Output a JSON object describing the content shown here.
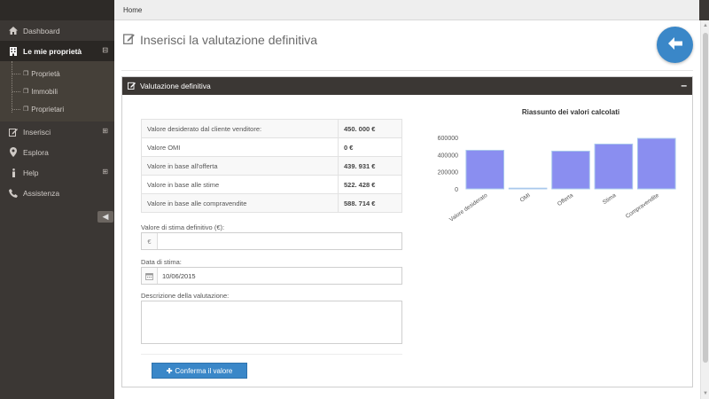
{
  "sidebar": {
    "items": [
      {
        "label": "Dashboard",
        "icon": "home-icon"
      },
      {
        "label": "Le mie proprietà",
        "icon": "building-icon"
      },
      {
        "label": "Inserisci",
        "icon": "edit-icon"
      },
      {
        "label": "Esplora",
        "icon": "map-marker-icon"
      },
      {
        "label": "Help",
        "icon": "info-icon"
      },
      {
        "label": "Assistenza",
        "icon": "phone-icon"
      }
    ],
    "subitems": [
      {
        "label": "Proprietà"
      },
      {
        "label": "Immobili"
      },
      {
        "label": "Proprietari"
      }
    ]
  },
  "breadcrumb": {
    "home": "Home"
  },
  "page": {
    "title": "Inserisci la valutazione definitiva"
  },
  "panel": {
    "title": "Valutazione definitiva"
  },
  "values_table": {
    "rows": [
      {
        "label": "Valore desiderato dal cliente venditore:",
        "value": "450. 000 €"
      },
      {
        "label": "Valore OMI",
        "value": "0 €"
      },
      {
        "label": "Valore in base all'offerta",
        "value": "439. 931 €"
      },
      {
        "label": "Valore in base alle stime",
        "value": "522. 428 €"
      },
      {
        "label": "Valore in base alle compravendite",
        "value": "588. 714 €"
      }
    ]
  },
  "form": {
    "stima_label": "Valore di stima definitivo (€):",
    "stima_addon": "€",
    "stima_value": "",
    "data_label": "Data di stima:",
    "data_value": "10/06/2015",
    "desc_label": "Descrizione della valutazione:",
    "desc_value": "",
    "confirm_label": "Conferma il valore"
  },
  "colors": {
    "accent": "#3a87c8",
    "sidebar_bg": "#3b3734",
    "bar_fill": "#8a8ef0",
    "bar_stroke": "#a9c8ec"
  },
  "chart_data": {
    "type": "bar",
    "title": "Riassunto dei valori calcolati",
    "categories": [
      "Valore desiderato",
      "OMI",
      "Offerta",
      "Stima",
      "Compravendite"
    ],
    "values": [
      450000,
      0,
      439931,
      522428,
      588714
    ],
    "yticks": [
      "0",
      "200000",
      "400000",
      "600000"
    ],
    "ylim": [
      0,
      600000
    ],
    "grid": false,
    "legend": "none",
    "xlabel": "",
    "ylabel": ""
  }
}
